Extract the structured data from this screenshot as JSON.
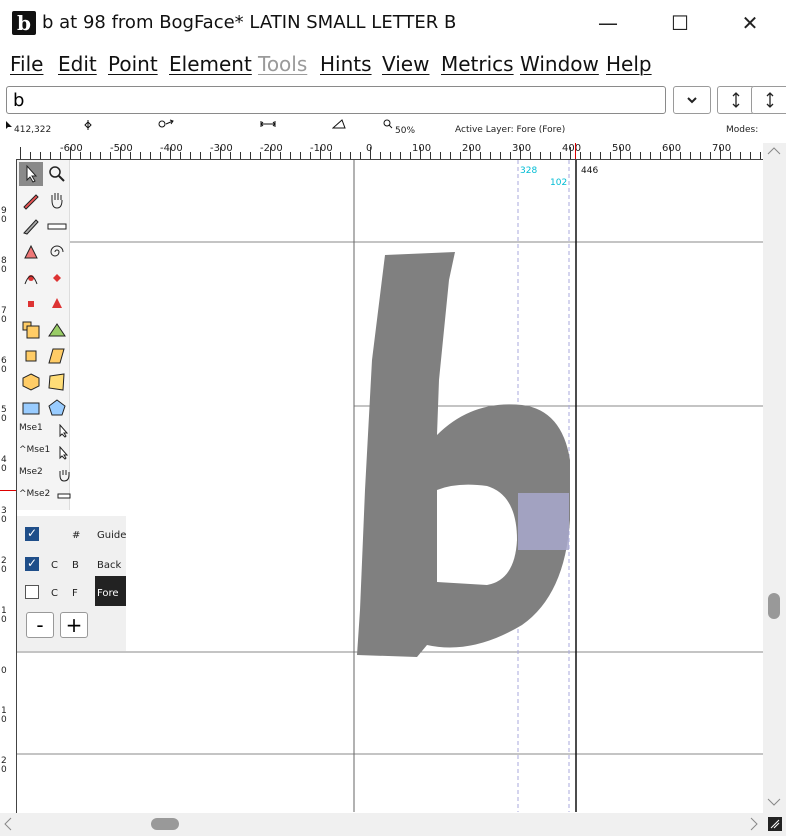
{
  "window": {
    "logo": "b",
    "title": "b at 98 from BogFace* LATIN SMALL LETTER B",
    "minimize_label": "—",
    "maximize_label": "☐",
    "close_label": "✕"
  },
  "menu": [
    "File",
    "Edit",
    "Point",
    "Element",
    "Tools",
    "Hints",
    "View",
    "Metrics",
    "Window",
    "Help"
  ],
  "glyph_field": {
    "value": "b"
  },
  "info": {
    "cursor": "412,322",
    "zoom": "50%",
    "active_layer": "Active Layer: Fore (Fore)",
    "modes": "Modes:"
  },
  "ruler": {
    "h_labels": [
      "-600",
      "-500",
      "-400",
      "-300",
      "-200",
      "-100",
      "0",
      "100",
      "200",
      "300",
      "400",
      "500",
      "600",
      "700"
    ],
    "v_labels": [
      "9\n0",
      "8\n0",
      "7\n0",
      "6\n0",
      "5\n0",
      "4\n0",
      "3\n0",
      "2\n0",
      "1\n0",
      "0",
      "1\n0",
      "2\n0"
    ]
  },
  "canvas": {
    "marker_328": "328",
    "marker_102": "102",
    "marker_446": "446",
    "accent": "#00bcd4"
  },
  "mouse_labels": [
    "Mse1",
    "^Mse1",
    "Mse2",
    "^Mse2"
  ],
  "layers": [
    {
      "checked": true,
      "col1": "",
      "col2": "#",
      "name": "Guide"
    },
    {
      "checked": true,
      "col1": "C",
      "col2": "B",
      "name": "Back"
    },
    {
      "checked": false,
      "col1": "C",
      "col2": "F",
      "name": "Fore"
    }
  ],
  "layer_buttons": {
    "remove": "-",
    "add": "+"
  },
  "colors": {
    "glyph": "#808080",
    "selection": "#a8a8cc",
    "active_layer_bg": "#222222"
  }
}
